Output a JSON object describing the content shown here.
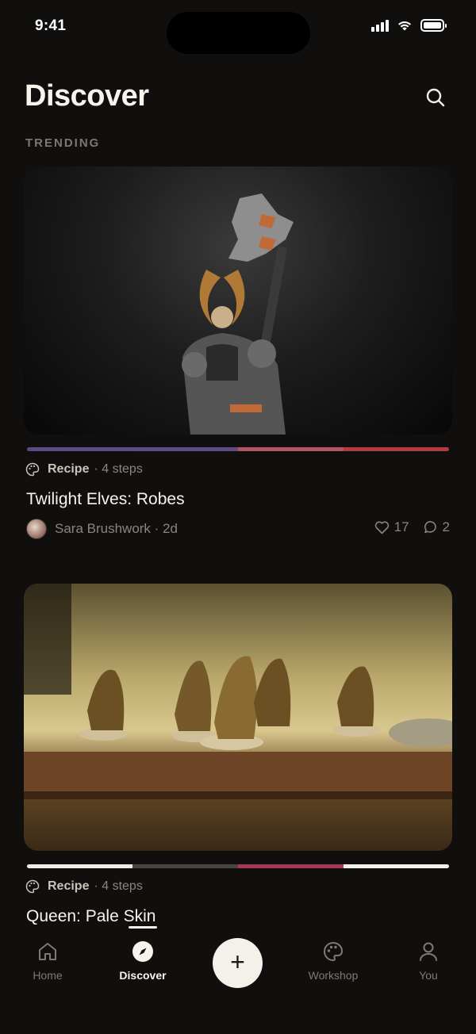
{
  "status": {
    "time": "9:41",
    "icons": [
      "signal-icon",
      "wifi-icon",
      "battery-icon"
    ]
  },
  "header": {
    "title": "Discover",
    "search_icon": "search-icon"
  },
  "section": {
    "label": "TRENDING"
  },
  "cards": [
    {
      "image": "painted-miniature-skeleton-warrior-photo",
      "palette": [
        "#5b4a86",
        "#5e4c82",
        "#b15565",
        "#b23a45"
      ],
      "type_icon": "palette-icon",
      "type": "Recipe",
      "steps": "· 4 steps",
      "title": "Twilight Elves: Robes",
      "author": "Sara Brushwork · 2d",
      "likes": "17",
      "comments": "2"
    },
    {
      "image": "painted-miniature-soldiers-on-shelf-photo",
      "palette": [
        "#f0ede6",
        "#4a4540",
        "#a63a56",
        "#f4f1ea"
      ],
      "type_icon": "palette-icon",
      "type": "Recipe",
      "steps": "· 4 steps",
      "title": "Queen: Pale Skin"
    }
  ],
  "tabs": [
    {
      "label": "Home",
      "icon": "home-icon"
    },
    {
      "label": "Discover",
      "icon": "compass-icon"
    },
    {
      "label": "Workshop",
      "icon": "palette-icon"
    },
    {
      "label": "You",
      "icon": "person-icon"
    }
  ],
  "fab": {
    "icon": "plus-icon",
    "symbol": "+"
  },
  "colors": {
    "background": "#110f0d",
    "text": "#f7f4ee",
    "muted": "#8a857d"
  }
}
